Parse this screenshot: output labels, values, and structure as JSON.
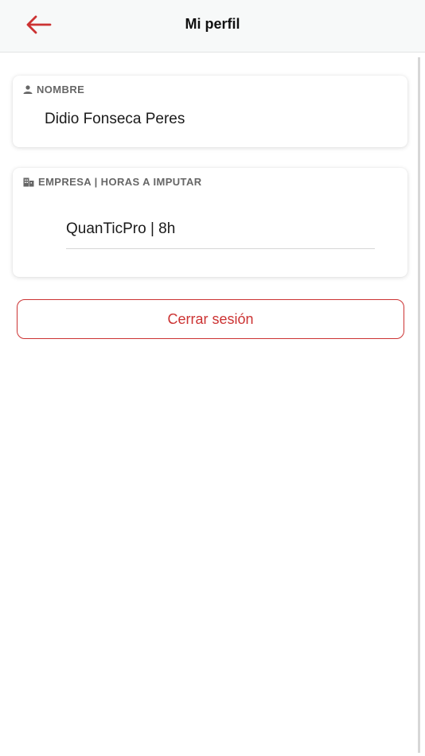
{
  "header": {
    "title": "Mi perfil",
    "back_icon": "arrow-left-icon",
    "accent_color": "#cc3333"
  },
  "profile": {
    "name_label": "NOMBRE",
    "name_icon": "person-icon",
    "name_value": "Didio Fonseca Peres"
  },
  "company": {
    "label": "EMPRESA | HORAS A IMPUTAR",
    "icon": "building-icon",
    "value": "QuanTicPro | 8h"
  },
  "actions": {
    "logout_label": "Cerrar sesión"
  }
}
